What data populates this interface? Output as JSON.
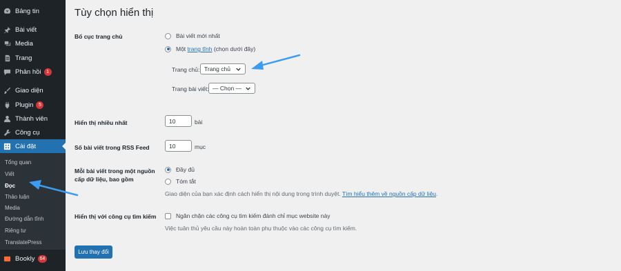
{
  "sidebar": {
    "items": [
      {
        "label": "Bảng tin",
        "icon": "dashboard-icon"
      },
      {
        "label": "Bài viết",
        "icon": "pin-icon"
      },
      {
        "label": "Media",
        "icon": "media-icon"
      },
      {
        "label": "Trang",
        "icon": "page-icon"
      },
      {
        "label": "Phản hồi",
        "icon": "comment-icon",
        "badge": "1"
      },
      {
        "label": "Giao diện",
        "icon": "brush-icon"
      },
      {
        "label": "Plugin",
        "icon": "plugin-icon",
        "badge": "5"
      },
      {
        "label": "Thành viên",
        "icon": "user-icon"
      },
      {
        "label": "Công cụ",
        "icon": "wrench-icon"
      },
      {
        "label": "Cài đặt",
        "icon": "settings-icon"
      },
      {
        "label": "Bookly",
        "icon": "bookly-icon",
        "badge": "64"
      }
    ],
    "submenu": [
      "Tổng quan",
      "Viết",
      "Đọc",
      "Thảo luận",
      "Media",
      "Đường dẫn tĩnh",
      "Riêng tư",
      "TranslatePress"
    ],
    "current_submenu": "Đọc"
  },
  "page": {
    "title": "Tùy chọn hiển thị",
    "homepage_layout": {
      "label": "Bố cục trang chủ",
      "option_latest": "Bài viết mới nhất",
      "option_static_prefix": "Một",
      "option_static_link": "trang tĩnh",
      "option_static_suffix": "(chọn dưới đây)",
      "homepage_label": "Trang chủ:",
      "homepage_value": "Trang chủ",
      "postspage_label": "Trang bài viết:",
      "postspage_value": "— Chọn —"
    },
    "posts_per_page": {
      "label": "Hiển thị nhiều nhất",
      "value": "10",
      "unit": "bài"
    },
    "posts_per_rss": {
      "label": "Số bài viết trong RSS Feed",
      "value": "10",
      "unit": "mục"
    },
    "rss_content": {
      "label": "Mỗi bài viết trong một nguồn cấp dữ liệu, bao gồm",
      "option_full": "Đầy đủ",
      "option_summary": "Tóm tắt",
      "desc_prefix": "Giao diện của bạn xác định cách hiển thị nội dung trong trình duyệt.",
      "desc_link": "Tìm hiểu thêm về nguồn cấp dữ liệu",
      "desc_suffix": "."
    },
    "search_visibility": {
      "label": "Hiển thị với công cụ tìm kiếm",
      "checkbox_label": "Ngăn chặn các công cụ tìm kiếm đánh chỉ mục website này",
      "desc": "Việc tuân thủ yêu cầu này hoàn toàn phụ thuộc vào các công cụ tìm kiếm."
    },
    "save_label": "Lưu thay đổi"
  },
  "colors": {
    "accent": "#2271b1",
    "sidebar": "#1d2327",
    "badge": "#d63638",
    "arrow": "#3c9cf0"
  }
}
